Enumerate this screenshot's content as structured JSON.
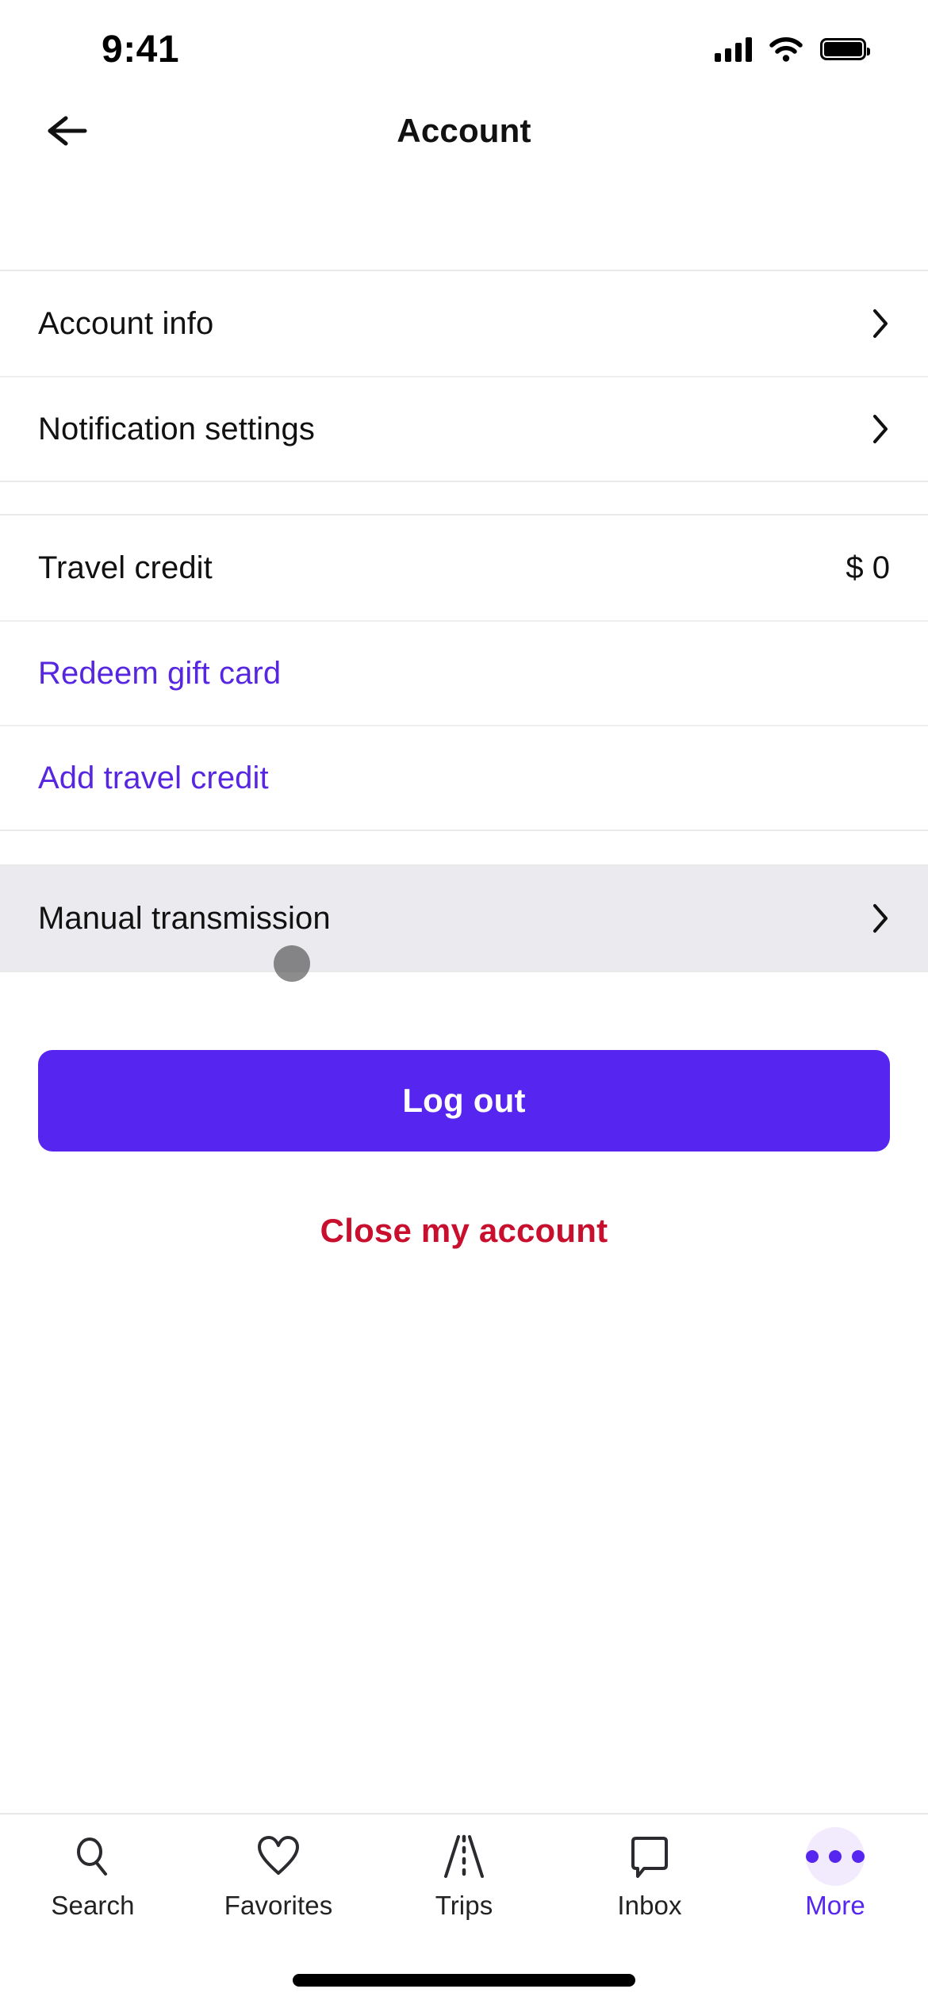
{
  "status_bar": {
    "time": "9:41",
    "cellular_icon": "cellular-signal-icon",
    "wifi_icon": "wifi-icon",
    "battery_icon": "battery-full-icon"
  },
  "header": {
    "back_icon": "arrow-left-icon",
    "title": "Account"
  },
  "sections": [
    {
      "id": "account-section",
      "rows": [
        {
          "label": "Account info",
          "accessory": "chevron-right-icon"
        },
        {
          "label": "Notification settings",
          "accessory": "chevron-right-icon"
        }
      ]
    },
    {
      "id": "credit-section",
      "rows": [
        {
          "label": "Travel credit",
          "value": "$ 0"
        },
        {
          "label": "Redeem gift card",
          "style": "link"
        },
        {
          "label": "Add travel credit",
          "style": "link"
        }
      ]
    },
    {
      "id": "preferences-section",
      "rows": [
        {
          "label": "Manual transmission",
          "accessory": "chevron-right-icon",
          "state": "pressed"
        }
      ]
    }
  ],
  "actions": {
    "logout_label": "Log out",
    "close_account_label": "Close my account"
  },
  "tab_bar": {
    "tabs": [
      {
        "label": "Search",
        "icon": "search-icon",
        "active": false
      },
      {
        "label": "Favorites",
        "icon": "heart-icon",
        "active": false
      },
      {
        "label": "Trips",
        "icon": "road-icon",
        "active": false
      },
      {
        "label": "Inbox",
        "icon": "speech-bubble-icon",
        "active": false
      },
      {
        "label": "More",
        "icon": "ellipsis-icon",
        "active": true
      }
    ]
  },
  "colors": {
    "accent_purple": "#5626f0",
    "danger_red": "#c8102e",
    "pressed_row_bg": "#ebeaee",
    "active_tab_bg": "#f2ebfd"
  },
  "home_indicator": "home-indicator-bar"
}
